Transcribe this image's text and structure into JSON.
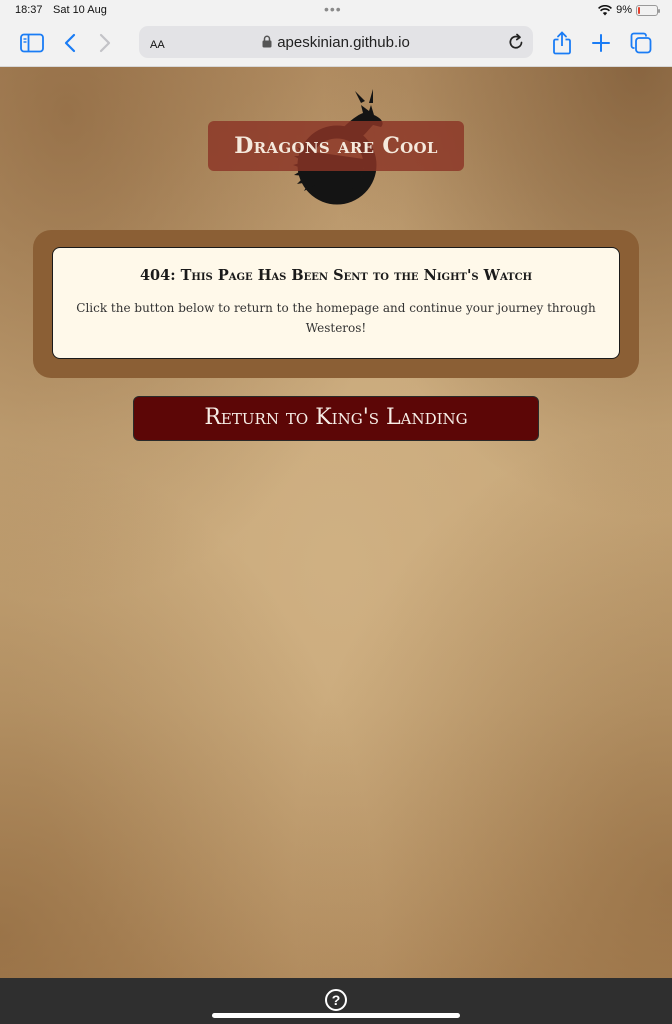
{
  "status_bar": {
    "time": "18:37",
    "date": "Sat 10 Aug",
    "battery": "9%",
    "battery_level": 0.09
  },
  "browser": {
    "text_size_label": "AA",
    "url": "apeskinian.github.io",
    "icons": [
      "sidebar-icon",
      "back-icon",
      "forward-icon",
      "lock-icon",
      "reload-icon",
      "share-icon",
      "new-tab-icon",
      "tabs-icon"
    ]
  },
  "site": {
    "title": "Dragons are Cool"
  },
  "error": {
    "title": "404: This Page Has Been Sent to the Night's Watch",
    "message": "Click the button below to return to the homepage and continue your journey through Westeros!"
  },
  "actions": {
    "return_label": "Return to King's Landing"
  },
  "colors": {
    "parchment": "#c4a67a",
    "frame": "#8b5f35",
    "card": "#fff9ea",
    "title_bg": "#8b3426",
    "button_bg": "#5c0606",
    "accent_blue": "#1a7cf5"
  }
}
